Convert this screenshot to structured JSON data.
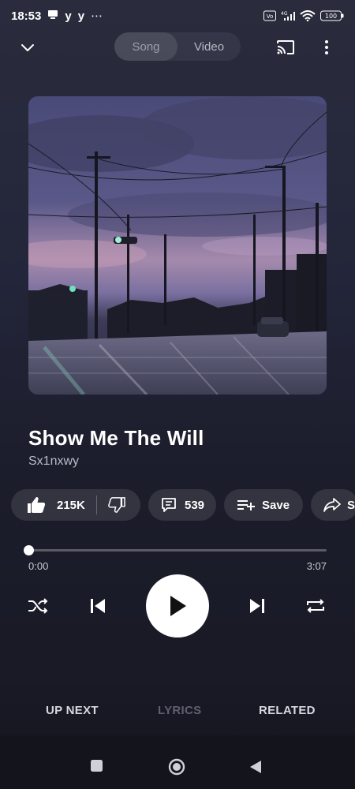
{
  "status_bar": {
    "time": "18:53",
    "left_icons": [
      "notification-icon",
      "y-app-icon",
      "y-app-icon",
      "more-dots"
    ],
    "y_letter": "y",
    "more": "⋯",
    "battery": "100",
    "network": "4G"
  },
  "top_bar": {
    "tabs": [
      {
        "label": "Song",
        "active": true
      },
      {
        "label": "Video",
        "active": false
      }
    ]
  },
  "track": {
    "title": "Show Me The Will",
    "artist": "Sx1nxwy"
  },
  "actions": {
    "likes": "215K",
    "comments": "539",
    "save": "Save",
    "share": "S"
  },
  "playback": {
    "current_time": "0:00",
    "total_time": "3:07",
    "progress": 0
  },
  "bottom_tabs": [
    {
      "label": "UP NEXT",
      "active": true
    },
    {
      "label": "LYRICS",
      "active": false
    },
    {
      "label": "RELATED",
      "active": true
    }
  ],
  "colors": {
    "background": "#1c1d2b",
    "pill": "#30313f",
    "muted_tab": "#5e6070"
  }
}
